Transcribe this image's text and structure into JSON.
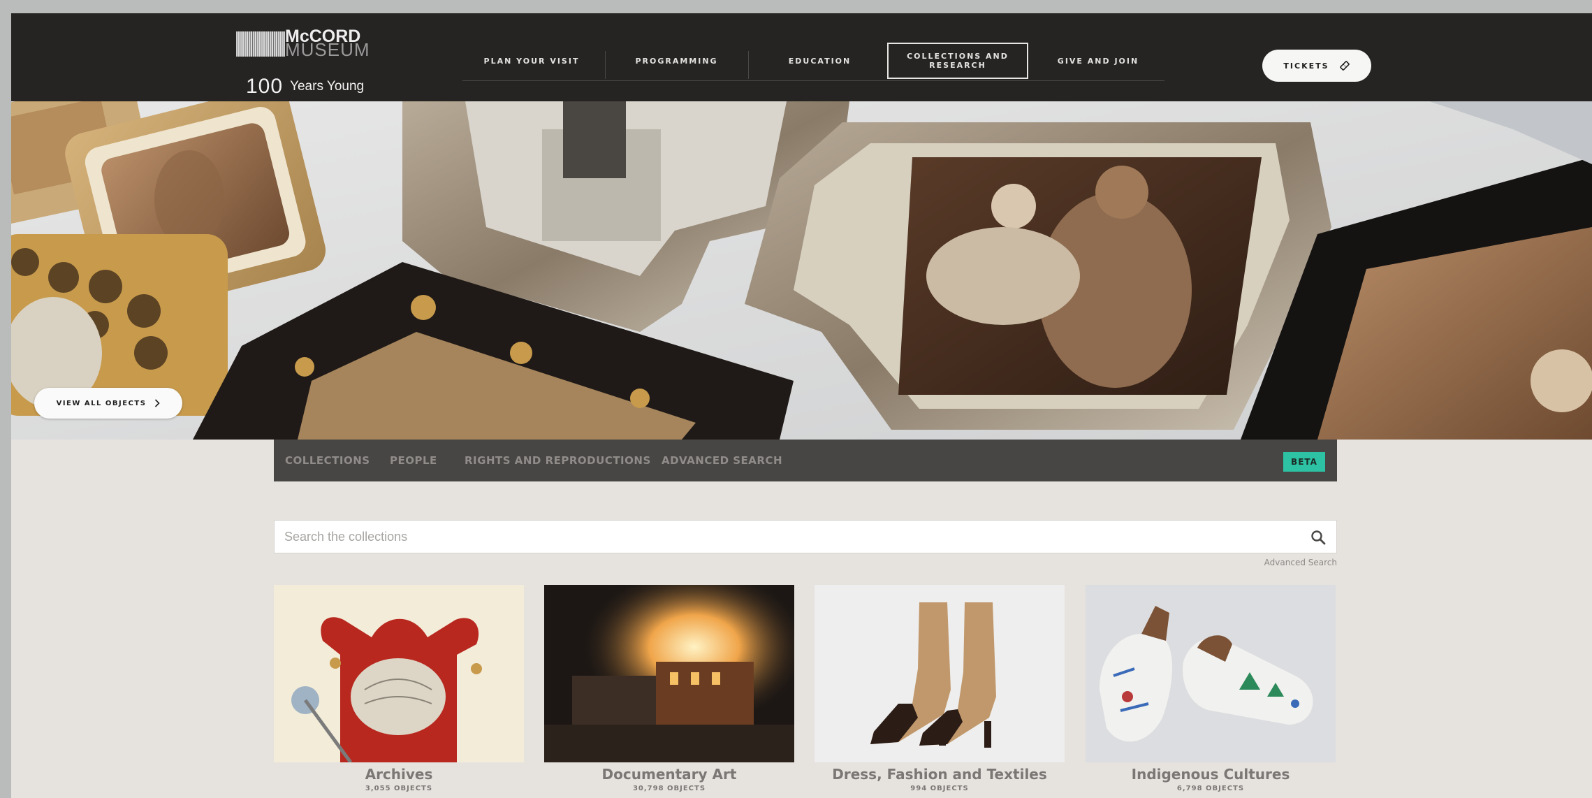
{
  "brand": {
    "name_line1": "McCORD",
    "name_line2": "MUSEUM",
    "tagline_number": "100",
    "tagline_text": "Years Young"
  },
  "nav": {
    "items": [
      {
        "label": "PLAN YOUR VISIT",
        "active": false
      },
      {
        "label": "PROGRAMMING",
        "active": false
      },
      {
        "label": "EDUCATION",
        "active": false
      },
      {
        "label": "COLLECTIONS AND RESEARCH",
        "active": true
      },
      {
        "label": "GIVE AND JOIN",
        "active": false
      }
    ],
    "tickets_label": "TICKETS",
    "tickets_icon": "ticket-icon"
  },
  "hero": {
    "view_all_label": "VIEW ALL OBJECTS",
    "view_all_icon": "chevron-right-icon"
  },
  "subnav": {
    "items": [
      "COLLECTIONS",
      "PEOPLE",
      "RIGHTS AND REPRODUCTIONS",
      "ADVANCED SEARCH"
    ],
    "badge": "BETA",
    "badge_color": "#2dc2a3"
  },
  "search": {
    "placeholder": "Search the collections",
    "value": "",
    "icon": "search-icon",
    "advanced_link": "Advanced Search"
  },
  "collections": [
    {
      "title": "Archives",
      "count": "3,055 OBJECTS"
    },
    {
      "title": "Documentary Art",
      "count": "30,798 OBJECTS"
    },
    {
      "title": "Dress, Fashion and Textiles",
      "count": "994 OBJECTS"
    },
    {
      "title": "Indigenous Cultures",
      "count": "6,798 OBJECTS"
    }
  ],
  "colors": {
    "header_bg": "#262423",
    "subnav_bg": "#484645",
    "page_bg": "#e6e3df"
  }
}
